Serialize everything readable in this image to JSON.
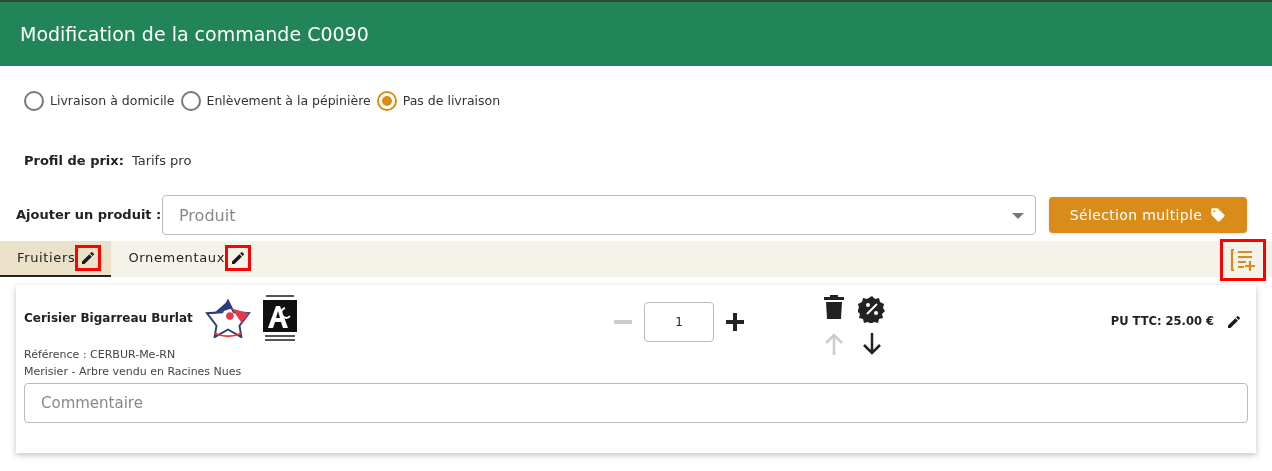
{
  "header": {
    "title": "Modification de la commande C0090"
  },
  "delivery_options": [
    {
      "label": "Livraison à domicile",
      "selected": false
    },
    {
      "label": "Enlèvement à la pépinière",
      "selected": false
    },
    {
      "label": "Pas de livraison",
      "selected": true
    }
  ],
  "price_profile": {
    "label": "Profil de prix:",
    "value": "Tarifs pro"
  },
  "add_product": {
    "label": "Ajouter un produit :",
    "placeholder": "Produit",
    "button": "Sélection multiple"
  },
  "tabs": [
    {
      "label": "Fruitiers",
      "selected": true,
      "highlighted": true
    },
    {
      "label": "Ornementaux",
      "selected": false,
      "highlighted": true
    }
  ],
  "add_block_button": {
    "highlighted": true
  },
  "products": [
    {
      "name": "Cerisier Bigarreau Burlat",
      "reference": "Référence : CERBUR-Me-RN",
      "description": "Merisier - Arbre vendu en Racines Nues",
      "quantity": "1",
      "decrease_disabled": true,
      "move_up_disabled": true,
      "move_down_disabled": false,
      "price": "PU TTC: 25.00 €",
      "comment_placeholder": "Commentaire"
    }
  ]
}
